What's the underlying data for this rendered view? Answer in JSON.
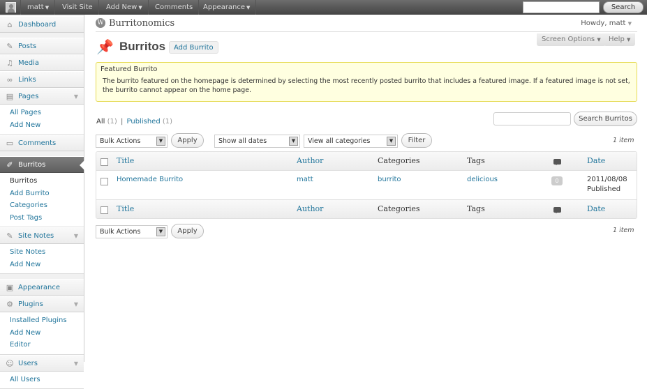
{
  "adminbar": {
    "user": "matt",
    "visit_site": "Visit Site",
    "add_new": "Add New",
    "comments": "Comments",
    "appearance": "Appearance",
    "search_button": "Search"
  },
  "sidebar": {
    "dashboard": "Dashboard",
    "posts": "Posts",
    "media": "Media",
    "links": "Links",
    "pages": "Pages",
    "pages_sub": [
      "All Pages",
      "Add New"
    ],
    "comments": "Comments",
    "burritos": "Burritos",
    "burritos_sub": [
      "Burritos",
      "Add Burrito",
      "Categories",
      "Post Tags"
    ],
    "site_notes": "Site Notes",
    "site_notes_sub": [
      "Site Notes",
      "Add New"
    ],
    "appearance": "Appearance",
    "plugins": "Plugins",
    "plugins_sub": [
      "Installed Plugins",
      "Add New",
      "Editor"
    ],
    "users": "Users",
    "users_sub": [
      "All Users"
    ]
  },
  "header": {
    "site_title": "Burritonomics",
    "howdy": "Howdy, matt",
    "screen_options": "Screen Options",
    "help": "Help"
  },
  "page": {
    "title": "Burritos",
    "add_button": "Add Burrito"
  },
  "notice": {
    "title": "Featured Burrito",
    "body": "The burrito featured on the homepage is determined by selecting the most recently posted burrito that includes a featured image.  If a featured image is not set, the burrito cannot appear on the home page."
  },
  "views": {
    "all": "All",
    "all_count": "(1)",
    "separator": "|",
    "published": "Published",
    "published_count": "(1)"
  },
  "search": {
    "button": "Search Burritos"
  },
  "filters": {
    "bulk_actions": "Bulk Actions",
    "apply": "Apply",
    "dates": "Show all dates",
    "categories": "View all categories",
    "filter": "Filter",
    "item_count": "1 item"
  },
  "table": {
    "columns": {
      "title": "Title",
      "author": "Author",
      "categories": "Categories",
      "tags": "Tags",
      "date": "Date"
    },
    "rows": [
      {
        "title": "Homemade Burrito",
        "author": "matt",
        "category": "burrito",
        "tag": "delicious",
        "comments": "0",
        "date": "2011/08/08",
        "status": "Published"
      }
    ]
  }
}
